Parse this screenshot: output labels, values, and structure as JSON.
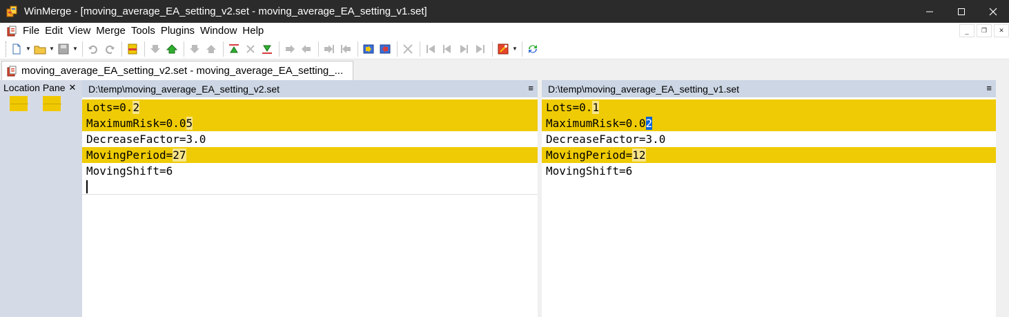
{
  "window": {
    "title": "WinMerge - [moving_average_EA_setting_v2.set - moving_average_EA_setting_v1.set]",
    "minimize": "—",
    "maximize": "☐",
    "close": "✕",
    "app_icon": "winmerge-logo-icon"
  },
  "menu": {
    "items": [
      "File",
      "Edit",
      "View",
      "Merge",
      "Tools",
      "Plugins",
      "Window",
      "Help"
    ],
    "mdi_minimize": "_",
    "mdi_restore": "❐",
    "mdi_close": "✕"
  },
  "toolbar": {
    "buttons": [
      "new-icon",
      "open-icon",
      "save-icon",
      "undo-icon",
      "redo-icon",
      "first-diff-icon",
      "next-diff-icon",
      "prev-diff-icon",
      "copy-left-icon",
      "copy-right-icon",
      "options-icon",
      "refresh-icon"
    ]
  },
  "tab": {
    "label": "moving_average_EA_setting_v2.set - moving_average_EA_setting_..."
  },
  "location_pane": {
    "title": "Location Pane",
    "close": "✕"
  },
  "left_pane": {
    "path": "D:\\temp\\moving_average_EA_setting_v2.set",
    "menu_glyph": "≡",
    "lines": [
      {
        "pre": "Lots=0.",
        "hl": "2",
        "post": "",
        "diff": true
      },
      {
        "pre": "MaximumRisk=0.0",
        "hl": "5",
        "post": "",
        "diff": true
      },
      {
        "pre": "DecreaseFactor=3.0",
        "hl": "",
        "post": "",
        "diff": false
      },
      {
        "pre": "MovingPeriod=",
        "hl": "27",
        "post": "",
        "diff": true
      },
      {
        "pre": "MovingShift=6",
        "hl": "",
        "post": "",
        "diff": false
      }
    ]
  },
  "right_pane": {
    "path": "D:\\temp\\moving_average_EA_setting_v1.set",
    "menu_glyph": "≡",
    "lines": [
      {
        "pre": "Lots=0.",
        "hl": "1",
        "post": "",
        "diff": true
      },
      {
        "pre": "MaximumRisk=0.0",
        "sel": "2",
        "post": "",
        "diff": true
      },
      {
        "pre": "DecreaseFactor=3.0",
        "hl": "",
        "post": "",
        "diff": false
      },
      {
        "pre": "MovingPeriod=",
        "hl": "12",
        "post": "",
        "diff": true
      },
      {
        "pre": "MovingShift=6",
        "hl": "",
        "post": "",
        "diff": false
      }
    ]
  },
  "colors": {
    "diff_line": "#efcb05",
    "diff_word": "#f8e58a",
    "selection": "#0a64d8",
    "pane_header": "#ccd6e4",
    "title_bar": "#2b2b2b"
  }
}
